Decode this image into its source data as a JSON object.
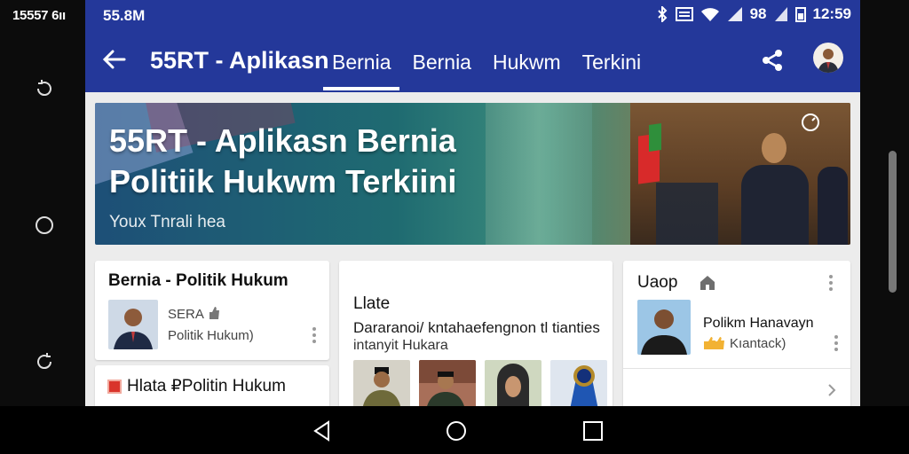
{
  "device": {
    "clock": "15557 6ıı"
  },
  "status_bar": {
    "carrier": "55.8M",
    "battery_text": "98",
    "time": "12:59"
  },
  "toolbar": {
    "app_title": "55RT - Aplikasn",
    "tabs": [
      {
        "label": "Bernia",
        "active": true
      },
      {
        "label": "Bernia",
        "active": false
      },
      {
        "label": "Hukwm",
        "active": false
      },
      {
        "label": "Terkini",
        "active": false
      }
    ]
  },
  "hero": {
    "title": "55RT - Aplikasn Bernia Politiik Hukwm Terkiini",
    "subtitle": "Youx Tnrali hea"
  },
  "cards": {
    "card1": {
      "heading": "Bernia - Politik Hukum",
      "meta1": "SERA",
      "meta2": "Politik Hukum)"
    },
    "card1b": {
      "heading": "Hlata ₽Politin Hukum"
    },
    "card2": {
      "heading": "Llate",
      "body1": "Dararanoi/ kntahaefengnon tl tianties",
      "body2": "intanyit Hukara"
    },
    "card3": {
      "heading": "Uaop",
      "title": "Polikm Hanavayn",
      "meta": "Kıantack)"
    }
  },
  "colors": {
    "app_bar": "#24389a",
    "background": "#ececec",
    "card": "#ffffff"
  },
  "icons": [
    "back-arrow-icon",
    "share-icon",
    "bluetooth-icon",
    "cast-icon",
    "wifi-icon",
    "signal-icon",
    "battery-icon",
    "home-icon",
    "kebab-menu-icon",
    "chevron-right-icon",
    "nav-back-icon",
    "nav-home-icon",
    "nav-recents-icon"
  ]
}
